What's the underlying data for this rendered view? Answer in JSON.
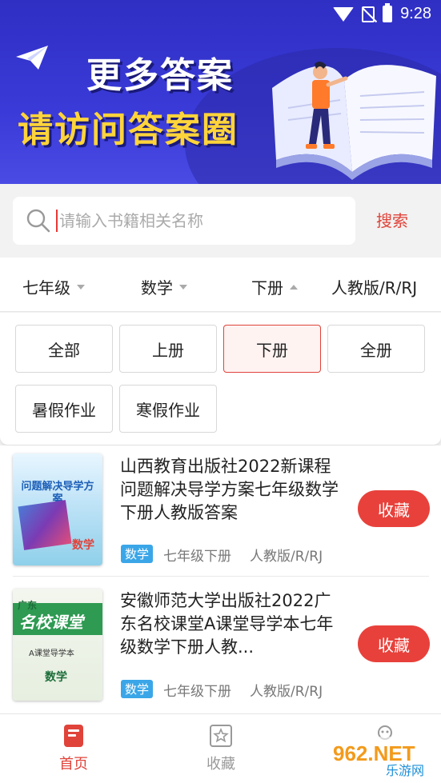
{
  "status_bar": {
    "time": "9:28"
  },
  "banner": {
    "line1": "更多答案",
    "line2": "请访问答案圈"
  },
  "search": {
    "placeholder": "请输入书籍相关名称",
    "value": "",
    "button_label": "搜索"
  },
  "filters": [
    {
      "label": "七年级",
      "arrow": "down"
    },
    {
      "label": "数学",
      "arrow": "down"
    },
    {
      "label": "下册",
      "arrow": "up"
    },
    {
      "label": "人教版/R/RJ",
      "arrow": "down"
    }
  ],
  "volume_options": [
    {
      "label": "全部",
      "selected": false
    },
    {
      "label": "上册",
      "selected": false
    },
    {
      "label": "下册",
      "selected": true
    },
    {
      "label": "全册",
      "selected": false
    },
    {
      "label": "暑假作业",
      "selected": false
    },
    {
      "label": "寒假作业",
      "selected": false
    }
  ],
  "books": [
    {
      "title": "山西教育出版社2022新课程问题解决导学方案七年级数学下册人教版答案",
      "subject_tag": "数学",
      "grade": "七年级下册",
      "edition": "人教版/R/RJ",
      "fav_label": "收藏",
      "cover_text": "问题解决导学方案",
      "cover_subject": "数学"
    },
    {
      "title": "安徽师范大学出版社2022广东名校课堂A课堂导学本七年级数学下册人教...",
      "subject_tag": "数学",
      "grade": "七年级下册",
      "edition": "人教版/R/RJ",
      "fav_label": "收藏",
      "cover_text": "名校课堂",
      "cover_region": "广东",
      "cover_sub": "A课堂导学本",
      "cover_subject": "数学"
    }
  ],
  "bottom_nav": [
    {
      "label": "首页",
      "active": true,
      "icon": "book-icon"
    },
    {
      "label": "收藏",
      "active": false,
      "icon": "star-icon"
    }
  ],
  "watermark": {
    "text": "962.NET 乐游网"
  },
  "colors": {
    "accent": "#e8413b",
    "banner": "#3232c8",
    "tag": "#3aa6e8",
    "headline_yellow": "#ffd43a"
  }
}
